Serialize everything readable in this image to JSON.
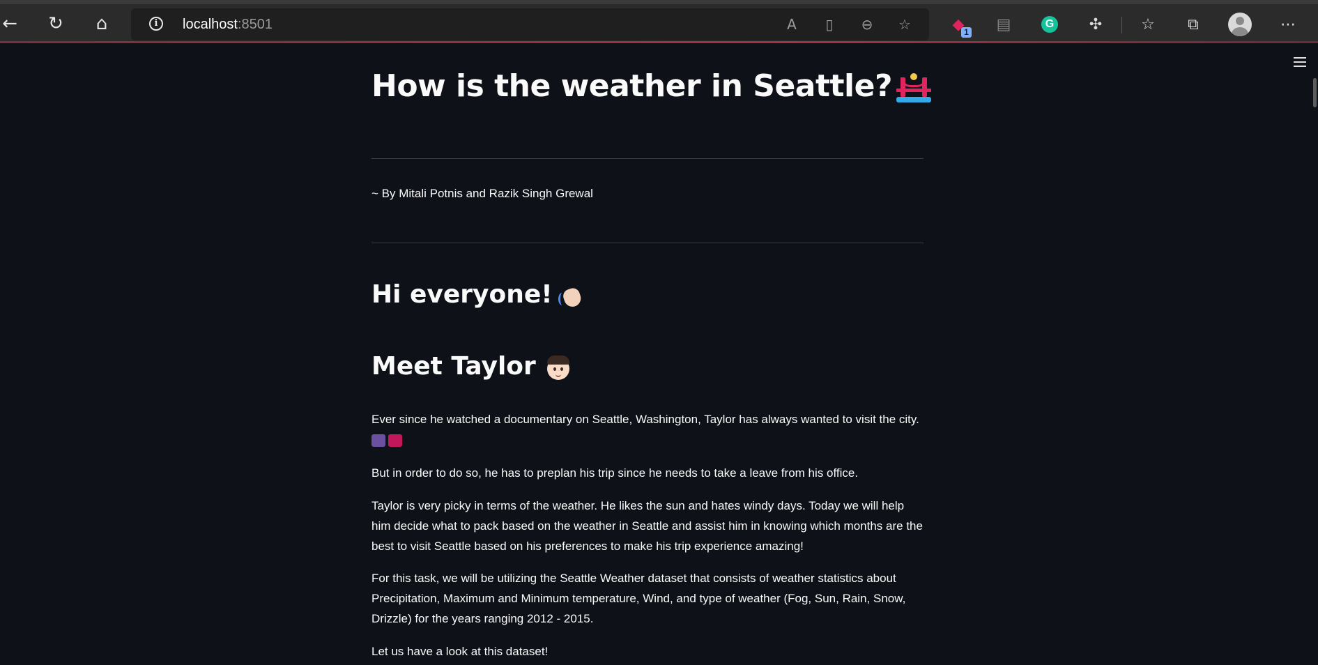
{
  "browser": {
    "url_host": "localhost",
    "url_port": ":8501",
    "extension_badge": "1",
    "grammarly_letter": "G",
    "icons": {
      "back": "back-arrow-icon",
      "refresh": "refresh-icon",
      "home": "home-icon",
      "site_info": "info-icon",
      "read_aloud": "read-aloud-icon",
      "immersive_reader": "immersive-reader-icon",
      "zoom_out": "zoom-out-icon",
      "add_favorite": "add-favorite-icon",
      "extension_red": "extension-icon",
      "extension_gray": "extension-icon",
      "grammarly": "grammarly-icon",
      "extensions": "puzzle-icon",
      "favorites": "favorites-icon",
      "collections": "collections-icon",
      "profile": "profile-avatar",
      "more": "more-icon"
    }
  },
  "app": {
    "menu_icon": "hamburger-icon",
    "title": "How is the weather in Seattle?",
    "byline": "~ By Mitali Potnis and Razik Singh Grewal",
    "greeting": "Hi everyone!",
    "meet_heading": "Meet Taylor",
    "paragraphs": [
      "Ever since he watched a documentary on Seattle, Washington, Taylor has always wanted to visit the city.",
      "But in order to do so, he has to preplan his trip since he needs to take a leave from his office.",
      "Taylor is very picky in terms of the weather. He likes the sun and hates windy days. Today we will help him decide what to pack based on the weather in Seattle and assist him in knowing which months are the best to visit Seattle based on his preferences to make his trip experience amazing!",
      "For this task, we will be utilizing the Seattle Weather dataset that consists of weather statistics about Precipitation, Maximum and Minimum temperature, Wind, and type of weather (Fog, Sun, Rain, Snow, Drizzle) for the years ranging 2012 - 2015.",
      "Let us have a look at this dataset!"
    ]
  },
  "colors": {
    "background": "#0e1117",
    "text": "#fafafa",
    "browser_chrome": "#2b2b2b",
    "address_bar": "#1f1f1f",
    "divider": "#3a3d45"
  }
}
